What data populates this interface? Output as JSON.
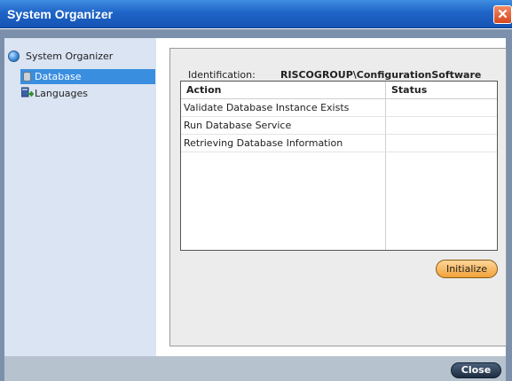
{
  "window": {
    "title": "System Organizer",
    "close_glyph": "✕"
  },
  "sidebar": {
    "root": {
      "label": "System Organizer",
      "icon": "globe-icon"
    },
    "items": [
      {
        "label": "Database",
        "icon": "database-icon",
        "selected": true
      },
      {
        "label": "Languages",
        "icon": "languages-icon",
        "selected": false
      }
    ]
  },
  "main": {
    "identification_label": "Identification:",
    "identification_value": "RISCOGROUP\\ConfigurationSoftware",
    "table": {
      "columns": [
        "Action",
        "Status"
      ],
      "rows": [
        {
          "action": "Validate Database Instance Exists",
          "status": ""
        },
        {
          "action": "Run Database Service",
          "status": ""
        },
        {
          "action": "Retrieving Database Information",
          "status": ""
        }
      ]
    },
    "initialize_label": "Initialize"
  },
  "footer": {
    "close_label": "Close"
  },
  "colors": {
    "titlebar": "#1f64c8",
    "selection": "#3a8ee0",
    "sidebar_bg": "#dae4f2",
    "accent_button": "#f0a23a",
    "close_button": "#1e2e42"
  }
}
